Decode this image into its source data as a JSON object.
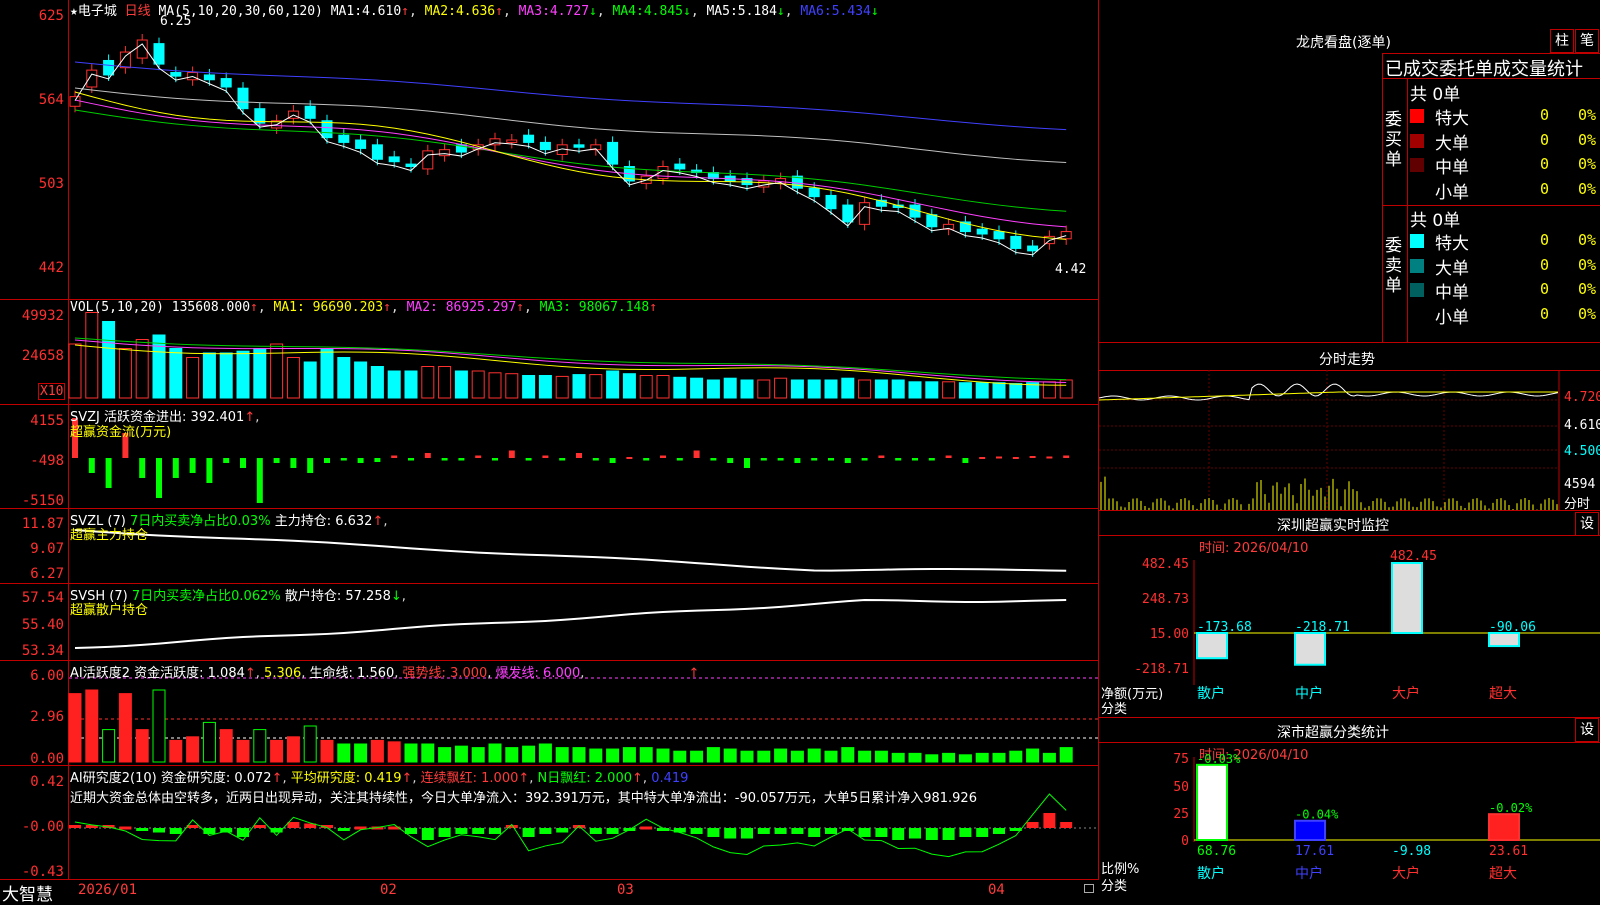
{
  "brand": "大智慧",
  "stock": {
    "name": "电子城",
    "period": "日线"
  },
  "main": {
    "ma_header": "MA(5,10,20,30,60,120)",
    "ma": [
      {
        "label": "MA1:",
        "value": "4.610",
        "arrow": "↑"
      },
      {
        "label": "MA2:",
        "value": "4.636",
        "arrow": "↑"
      },
      {
        "label": "MA3:",
        "value": "4.727",
        "arrow": "↓"
      },
      {
        "label": "MA4:",
        "value": "4.845",
        "arrow": "↓"
      },
      {
        "label": "MA5:",
        "value": "5.184",
        "arrow": "↓"
      },
      {
        "label": "MA6:",
        "value": "5.434",
        "arrow": "↓"
      }
    ],
    "y_ticks": [
      "625",
      "564",
      "503",
      "442"
    ],
    "high_label": "6.25",
    "low_label": "4.42"
  },
  "vol": {
    "header": "VOL(5,10,20)",
    "value": "135608.000",
    "ma1": "MA1: 96690.203",
    "ma2": "MA2: 86925.297",
    "ma3": "MA3: 98067.148",
    "y_ticks": [
      "49932",
      "24658"
    ],
    "unit": "X10"
  },
  "svzj": {
    "header": "SVZJ",
    "label": "活跃资金进出: 392.401",
    "sub": "超赢资金流(万元)",
    "y_ticks": [
      "4155",
      "-498",
      "-5150"
    ]
  },
  "svzl": {
    "header": "SVZL (7)",
    "label1": "7日内买卖净占比0.03%",
    "label2": "主力持仓: 6.632",
    "sub": "超赢主力持仓",
    "y_ticks": [
      "11.87",
      "9.07",
      "6.27"
    ]
  },
  "svsh": {
    "header": "SVSH (7)",
    "label1": "7日内买卖净占比0.062%",
    "label2": "散户持仓: 57.258",
    "sub": "超赢散户持仓",
    "y_ticks": [
      "57.54",
      "55.40",
      "53.34"
    ]
  },
  "ai2": {
    "header": "AI活跃度2",
    "l1": "资金活跃度: 1.084",
    "l2": "5.306",
    "l3": "生命线: 1.560",
    "l4": "强势线: 3.000",
    "l5": "爆发线: 6.000",
    "y_ticks": [
      "6.00",
      "2.96",
      "0.00"
    ]
  },
  "ai_research": {
    "header": "AI研究度2(10)",
    "l1": "资金研究度: 0.072",
    "l2": "平均研究度: 0.419",
    "l3": "连续飘红: 1.000",
    "l4": "N日飘红: 2.000",
    "l5": "0.419",
    "text": "近期大资金总体由空转多，近两日出现异动，关注其持续性，今日大单净流入：392.391万元，其中特大单净流出：-90.057万元，大单5日累计净入981.926",
    "y_ticks": [
      "0.42",
      "-0.00",
      "-0.43"
    ]
  },
  "x_axis": [
    "2026/01",
    "02",
    "03",
    "04"
  ],
  "longhu": {
    "title": "龙虎看盘(逐单)",
    "btn1": "柱",
    "btn2": "笔",
    "section_title": "已成交委托单成交量统计",
    "buy_label": "委买单",
    "sell_label": "委卖单",
    "buy_total": "共 0单",
    "sell_total": "共 0单",
    "buy_rows": [
      {
        "name": "特大",
        "count": "0",
        "pct": "0%",
        "color": "#ff0000"
      },
      {
        "name": "大单",
        "count": "0",
        "pct": "0%",
        "color": "#a00000"
      },
      {
        "name": "中单",
        "count": "0",
        "pct": "0%",
        "color": "#600000"
      },
      {
        "name": "小单",
        "count": "0",
        "pct": "0%",
        "color": ""
      }
    ],
    "sell_rows": [
      {
        "name": "特大",
        "count": "0",
        "pct": "0%",
        "color": "#00ffff"
      },
      {
        "name": "大单",
        "count": "0",
        "pct": "0%",
        "color": "#008080"
      },
      {
        "name": "中单",
        "count": "0",
        "pct": "0%",
        "color": "#006060"
      },
      {
        "name": "小单",
        "count": "0",
        "pct": "0%",
        "color": ""
      }
    ]
  },
  "intraday": {
    "title": "分时走势",
    "y_ticks": [
      "4.720",
      "4.610",
      "4.500"
    ],
    "vol_tick": "4594",
    "vol_unit": "分时"
  },
  "monitor": {
    "title": "深圳超赢实时监控",
    "btn": "设",
    "date": "时间: 2026/04/10",
    "y_ticks": [
      "482.45",
      "248.73",
      "15.00",
      "-218.71"
    ],
    "label": "净额(万元)",
    "sub": "分类",
    "bars": [
      {
        "cat": "散户",
        "value": "-173.68"
      },
      {
        "cat": "中户",
        "value": "-218.71"
      },
      {
        "cat": "大户",
        "value": "482.45"
      },
      {
        "cat": "超大",
        "value": "-90.06"
      }
    ]
  },
  "classify": {
    "title": "深市超赢分类统计",
    "btn": "设",
    "date": "时间: 2026/04/10",
    "y_ticks": [
      "75",
      "50",
      "25",
      "0"
    ],
    "label": "比例%",
    "sub": "分类",
    "bars": [
      {
        "cat": "散户",
        "value": "68.76",
        "top": "-0.03%"
      },
      {
        "cat": "中户",
        "value": "17.61",
        "top": "-0.04%"
      },
      {
        "cat": "大户",
        "value": "-9.98",
        "top": ""
      },
      {
        "cat": "超大",
        "value": "23.61",
        "top": "-0.02%"
      }
    ]
  },
  "colors": {
    "frame": "#c00000",
    "up": "#ff3030",
    "down": "#00ffff",
    "green": "#00ff00",
    "yellow": "#ffff00"
  }
}
